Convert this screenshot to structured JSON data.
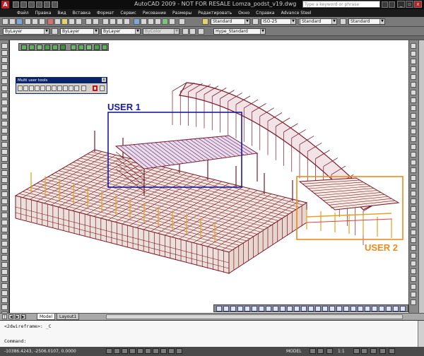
{
  "window": {
    "app_logo": "A",
    "title": "AutoCAD 2009 - NOT FOR RESALE  Lomza_podst_v19.dwg",
    "search_placeholder": "Type a keyword or phrase",
    "close_glyph": "x"
  },
  "menu": [
    "Файл",
    "Правка",
    "Вид",
    "Вставка",
    "Формат",
    "Сервис",
    "Рисование",
    "Размеры",
    "Редактировать",
    "Окно",
    "Справка",
    "Advance Steel"
  ],
  "styles_toolbar": {
    "text_style": "Standard",
    "dim_style": "ISO-25",
    "table_style": "Standard",
    "multileader_style": "Standard"
  },
  "properties_toolbar": {
    "layer": "ByLayer",
    "color": "ByLayer",
    "linetype": "ByLayer",
    "lineweight": "ByColor",
    "plot_style": "Hype_Standard"
  },
  "floating_toolbar": {
    "title": "Multi user tools",
    "close_glyph": "x"
  },
  "annotations": {
    "user1": {
      "label": "USER 1",
      "color": "#1a1a9e"
    },
    "user2": {
      "label": "USER 2",
      "color": "#f08a1c"
    }
  },
  "layout_tabs": {
    "model": "Model",
    "layout1": "Layout1"
  },
  "command_window": {
    "history": "<2dwireframe>: _C",
    "prompt": "Command:"
  },
  "status_bar": {
    "coordinates": "-10386.4243, -2506.0107, 0.0000",
    "space": "MODEL",
    "scale": "1:1"
  },
  "colors": {
    "structure_main": "#7a1a2a",
    "structure_accent": "#e8a020",
    "canvas": "#ffffff"
  }
}
